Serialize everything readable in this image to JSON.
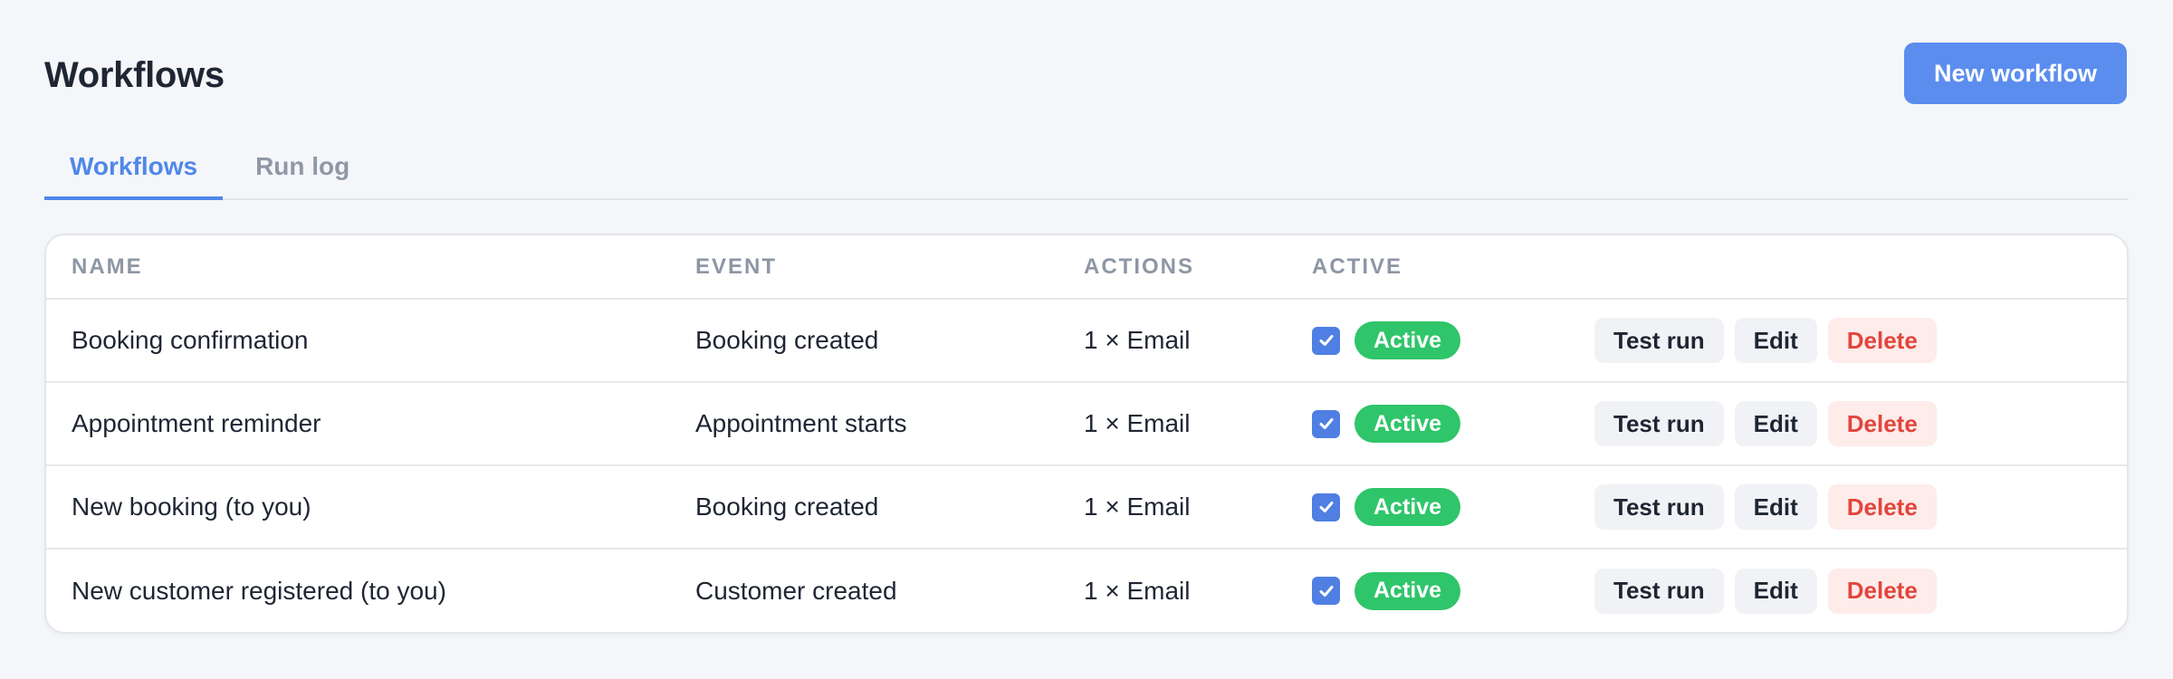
{
  "header": {
    "title": "Workflows",
    "new_button_label": "New workflow"
  },
  "tabs": [
    {
      "label": "Workflows",
      "active": true
    },
    {
      "label": "Run log",
      "active": false
    }
  ],
  "table": {
    "columns": [
      "NAME",
      "EVENT",
      "ACTIONS",
      "ACTIVE",
      ""
    ],
    "rows": [
      {
        "name": "Booking confirmation",
        "event": "Booking created",
        "actions": "1 × Email",
        "active": true,
        "status": "Active"
      },
      {
        "name": "Appointment reminder",
        "event": "Appointment starts",
        "actions": "1 × Email",
        "active": true,
        "status": "Active"
      },
      {
        "name": "New booking (to you)",
        "event": "Booking created",
        "actions": "1 × Email",
        "active": true,
        "status": "Active"
      },
      {
        "name": "New customer registered (to you)",
        "event": "Customer created",
        "actions": "1 × Email",
        "active": true,
        "status": "Active"
      }
    ],
    "row_buttons": {
      "test_run": "Test run",
      "edit": "Edit",
      "delete": "Delete"
    }
  },
  "colors": {
    "accent": "#5b8def",
    "tab_active": "#4f87ea",
    "badge_active": "#2fc56a",
    "danger_text": "#e2453c",
    "danger_bg": "#fdecea",
    "page_bg": "#f5f6f9"
  },
  "icons": {
    "checkbox": "check-icon"
  }
}
